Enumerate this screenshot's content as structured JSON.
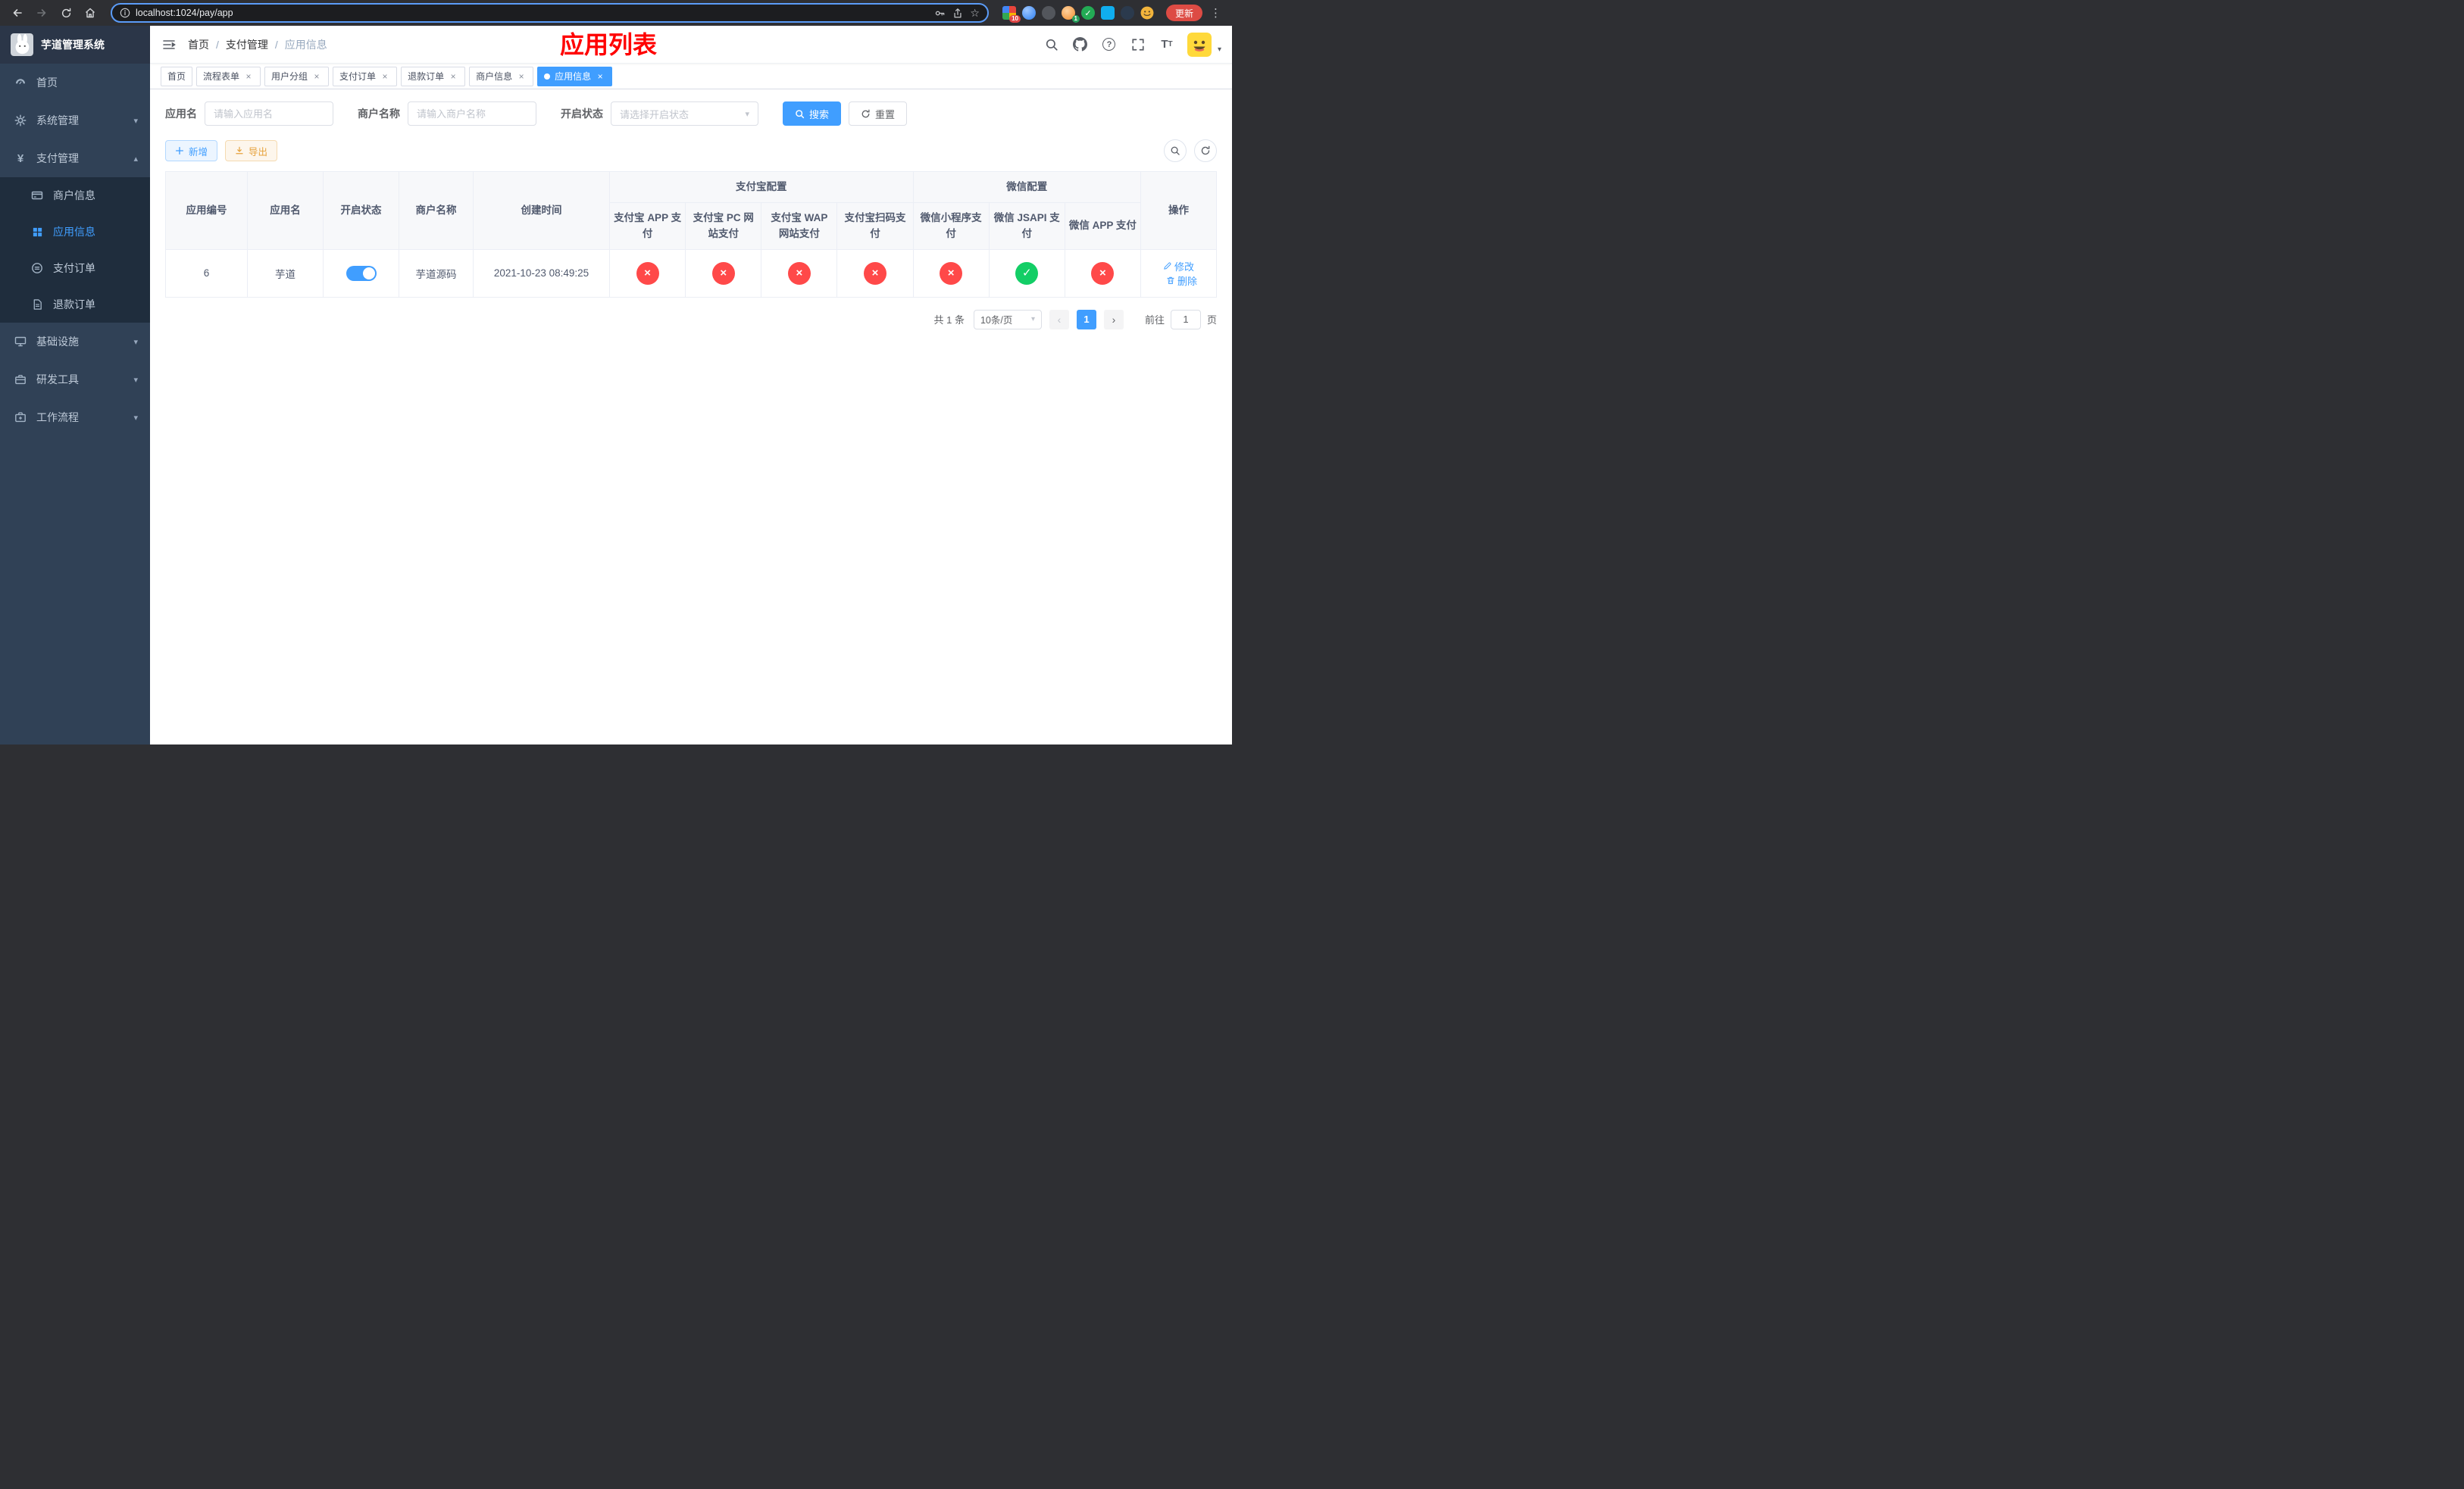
{
  "browser": {
    "url": "localhost:1024/pay/app",
    "update_label": "更新",
    "ext_badge_1": "10",
    "ext_badge_2": "1"
  },
  "sidebar": {
    "title": "芋道管理系统",
    "items": [
      {
        "label": "首页",
        "icon": "dashboard-icon"
      },
      {
        "label": "系统管理",
        "icon": "gear-icon",
        "expandable": true
      },
      {
        "label": "支付管理",
        "icon": "yen-icon",
        "expandable": true,
        "expanded": true
      },
      {
        "label": "基础设施",
        "icon": "monitor-icon",
        "expandable": true
      },
      {
        "label": "研发工具",
        "icon": "toolbox-icon",
        "expandable": true
      },
      {
        "label": "工作流程",
        "icon": "workflow-icon",
        "expandable": true
      }
    ],
    "payment_children": [
      {
        "label": "商户信息",
        "icon": "card-icon",
        "active": false
      },
      {
        "label": "应用信息",
        "icon": "grid-icon",
        "active": true
      },
      {
        "label": "支付订单",
        "icon": "order-icon",
        "active": false
      },
      {
        "label": "退款订单",
        "icon": "refund-icon",
        "active": false
      }
    ]
  },
  "header": {
    "breadcrumb": [
      "首页",
      "支付管理",
      "应用信息"
    ],
    "title": "应用列表"
  },
  "tabs": [
    {
      "label": "首页",
      "closable": false,
      "active": false
    },
    {
      "label": "流程表单",
      "closable": true,
      "active": false
    },
    {
      "label": "用户分组",
      "closable": true,
      "active": false
    },
    {
      "label": "支付订单",
      "closable": true,
      "active": false
    },
    {
      "label": "退款订单",
      "closable": true,
      "active": false
    },
    {
      "label": "商户信息",
      "closable": true,
      "active": false
    },
    {
      "label": "应用信息",
      "closable": true,
      "active": true
    }
  ],
  "filters": {
    "app_name_label": "应用名",
    "app_name_placeholder": "请输入应用名",
    "merchant_label": "商户名称",
    "merchant_placeholder": "请输入商户名称",
    "status_label": "开启状态",
    "status_placeholder": "请选择开启状态",
    "search_label": "搜索",
    "reset_label": "重置"
  },
  "toolbar": {
    "add_label": "新增",
    "export_label": "导出"
  },
  "table": {
    "col_app_id": "应用编号",
    "col_app_name": "应用名",
    "col_status": "开启状态",
    "col_merchant": "商户名称",
    "col_created": "创建时间",
    "group_alipay": "支付宝配置",
    "group_wechat": "微信配置",
    "sub_headers": [
      "支付宝 APP 支付",
      "支付宝 PC 网站支付",
      "支付宝 WAP 网站支付",
      "支付宝扫码支付",
      "微信小程序支付",
      "微信 JSAPI 支付",
      "微信 APP 支付"
    ],
    "col_actions": "操作",
    "rows": [
      {
        "app_id": "6",
        "app_name": "芋道",
        "enabled": true,
        "merchant": "芋道源码",
        "created": "2021-10-23 08:49:25",
        "statuses": [
          "error",
          "error",
          "error",
          "error",
          "error",
          "success",
          "error"
        ],
        "edit_label": "修改",
        "delete_label": "删除"
      }
    ]
  },
  "pagination": {
    "total": "共 1 条",
    "page_size": "10条/页",
    "page": "1",
    "goto_label": "前往",
    "goto_value": "1",
    "unit": "页"
  }
}
